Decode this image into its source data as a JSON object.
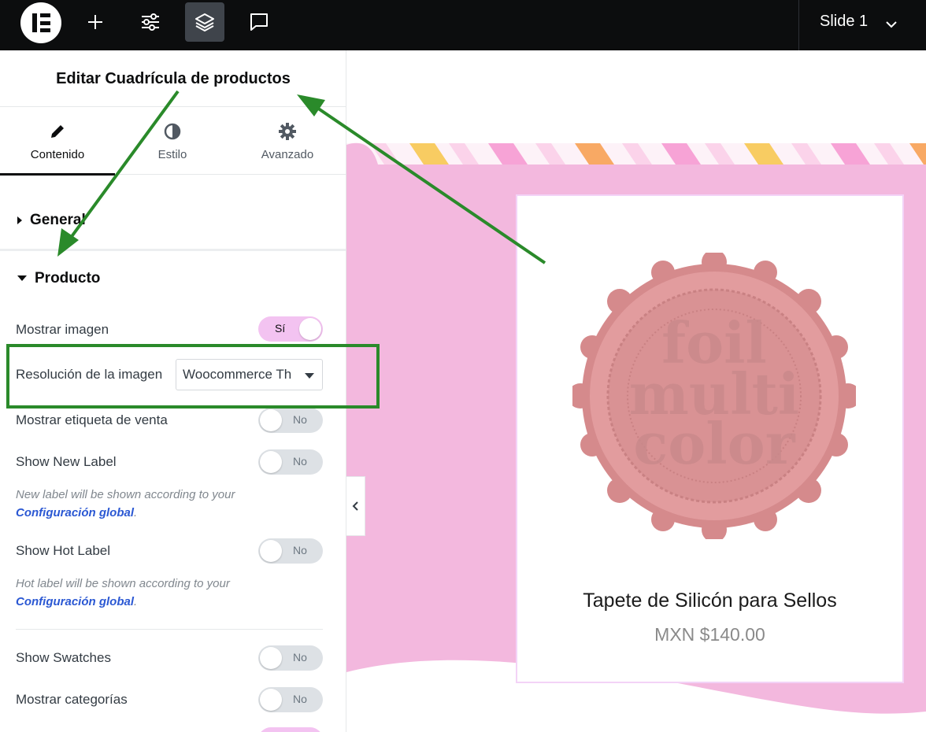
{
  "topbar": {
    "logo_icon": "elementor-logo-icon",
    "buttons": [
      {
        "icon": "plus-icon"
      },
      {
        "icon": "sliders-icon"
      },
      {
        "icon": "layers-icon",
        "active": true
      },
      {
        "icon": "comment-icon"
      }
    ],
    "slide_selector": {
      "label": "Slide 1",
      "icon": "chevron-down-icon"
    }
  },
  "panel": {
    "title": "Editar Cuadrícula de productos",
    "tabs": [
      {
        "label": "Contenido",
        "icon": "pencil-icon",
        "active": true
      },
      {
        "label": "Estilo",
        "icon": "half-circle-icon",
        "active": false
      },
      {
        "label": "Avanzado",
        "icon": "gear-icon",
        "active": false
      }
    ],
    "sections": {
      "general": {
        "label": "General"
      },
      "producto": {
        "label": "Producto"
      }
    },
    "controls": {
      "mostrar_imagen": {
        "label": "Mostrar imagen",
        "state": "Sí"
      },
      "resolucion": {
        "label": "Resolución de la imagen",
        "value": "Woocommerce Th"
      },
      "etiqueta_venta": {
        "label": "Mostrar etiqueta de venta",
        "state": "No"
      },
      "new_label": {
        "label": "Show New Label",
        "state": "No"
      },
      "new_note": {
        "text": "New label will be shown according to your",
        "link": "Configuración global",
        "suffix": "."
      },
      "hot_label": {
        "label": "Show Hot Label",
        "state": "No"
      },
      "hot_note": {
        "text": "Hot label will be shown according to your",
        "link": "Configuración global",
        "suffix": "."
      },
      "swatches": {
        "label": "Show Swatches",
        "state": "No"
      },
      "categorias": {
        "label": "Mostrar categorías",
        "state": "No"
      }
    }
  },
  "product": {
    "title": "Tapete de Silicón para Sellos",
    "price": "MXN $140.00",
    "image_text": [
      "foil",
      "multi",
      "color"
    ]
  },
  "colors": {
    "accent_green": "#2a8a2a",
    "pink_bg": "#f3b8de",
    "toggle_on": "#f3c3f1",
    "link_blue": "#2b58d3"
  }
}
